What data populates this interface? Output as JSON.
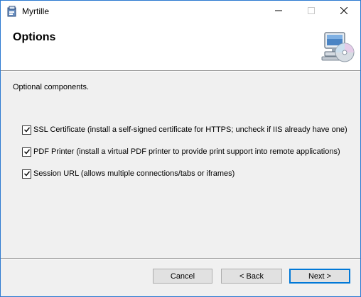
{
  "window": {
    "title": "Myrtille",
    "app_icon": "installer-icon",
    "controls": {
      "minimize": "minimize-icon",
      "maximize": "maximize-icon",
      "close": "close-icon"
    }
  },
  "header": {
    "title": "Options",
    "icon": "computer-cd-icon"
  },
  "main": {
    "description": "Optional components.",
    "options": [
      {
        "label": "SSL Certificate (install a self-signed certificate for HTTPS; uncheck if IIS already have one)",
        "checked": true
      },
      {
        "label": "PDF Printer (install a virtual PDF printer to provide print support into remote applications)",
        "checked": true
      },
      {
        "label": "Session URL (allows multiple connections/tabs or iframes)",
        "checked": true
      }
    ]
  },
  "footer": {
    "cancel_label": "Cancel",
    "back_label": "< Back",
    "next_label": "Next >"
  },
  "colors": {
    "accent": "#0078d7",
    "border": "#2b79d1",
    "desktop": "#1d5fa8"
  }
}
